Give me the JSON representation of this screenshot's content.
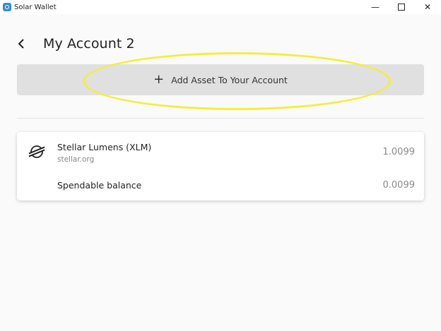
{
  "window": {
    "title": "Solar Wallet",
    "minimize_glyph": "—",
    "close_glyph": "✕"
  },
  "header": {
    "title": "My Account 2",
    "back_icon": "chevron-left-icon"
  },
  "add_asset": {
    "icon": "+",
    "label": "Add Asset To Your Account"
  },
  "assets": [
    {
      "name": "Stellar Lumens (XLM)",
      "domain": "stellar.org",
      "balance": "1.0099",
      "icon": "stellar-logo-icon"
    }
  ],
  "spendable": {
    "label": "Spendable balance",
    "value": "0.0099"
  },
  "colors": {
    "highlight": "#f3ee3a",
    "button_bg": "#e0e0e0",
    "app_icon": "#2f8fd8"
  }
}
